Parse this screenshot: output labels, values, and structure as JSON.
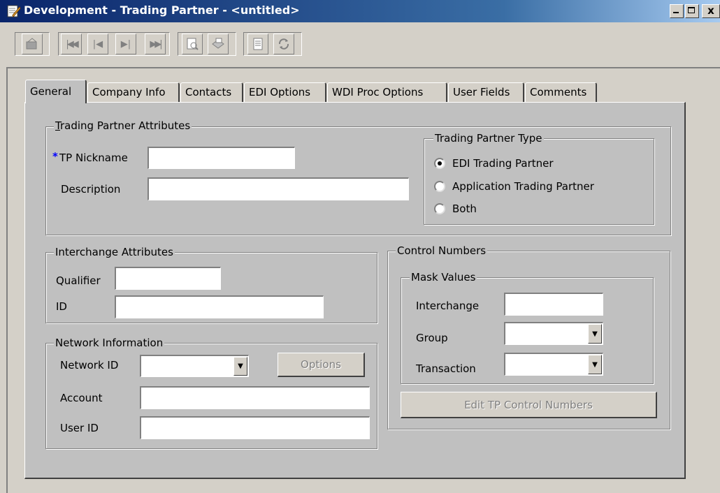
{
  "window": {
    "title": "Development - Trading Partner - <untitled>",
    "controls": {
      "minimize": "_",
      "maximize": "□",
      "close": "x"
    }
  },
  "toolbar": {
    "buttons": [
      "exit-icon",
      "first-record-icon",
      "previous-record-icon",
      "next-record-icon",
      "last-record-icon",
      "print-preview-icon",
      "print-icon",
      "notes-icon",
      "refresh-icon"
    ]
  },
  "tabs": [
    "General",
    "Company Info",
    "Contacts",
    "EDI Options",
    "WDI Proc Options",
    "User Fields",
    "Comments"
  ],
  "active_tab": "General",
  "tp_attributes": {
    "legend": "Trading Partner Attributes",
    "legend_accel": "T",
    "required_mark": "*",
    "nickname_label": "TP Nickname",
    "nickname_value": "",
    "description_label": "Description",
    "description_value": ""
  },
  "tp_type": {
    "legend": "Trading Partner Type",
    "options": [
      "EDI Trading Partner",
      "Application Trading Partner",
      "Both"
    ],
    "selected": "EDI Trading Partner"
  },
  "interchange": {
    "legend": "Interchange Attributes",
    "qualifier_label": "Qualifier",
    "id_label": "ID"
  },
  "network": {
    "legend": "Network Information",
    "network_id_label": "Network ID",
    "options_button": "Options",
    "account_label": "Account",
    "user_id_label": "User ID"
  },
  "control_numbers": {
    "legend": "Control Numbers",
    "mask_legend": "Mask Values",
    "interchange_label": "Interchange",
    "group_label": "Group",
    "transaction_label": "Transaction",
    "edit_button": "Edit TP Control Numbers"
  },
  "colors": {
    "required_mark": "#0000ff",
    "title_bar": "#0a246a",
    "face": "#d4d0c8",
    "panel": "#c0c0c0"
  }
}
